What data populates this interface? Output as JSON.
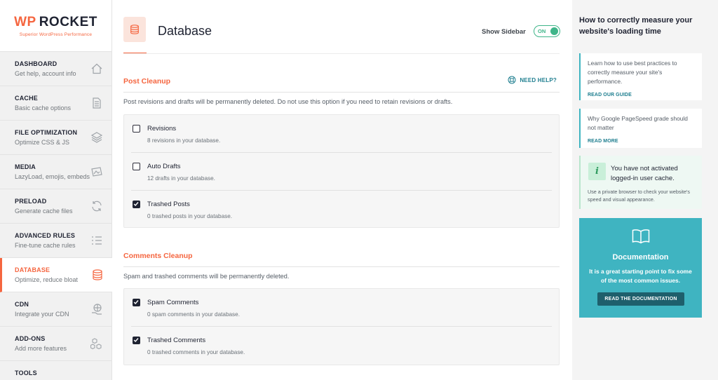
{
  "app": {
    "logo_wp": "WP",
    "logo_rocket": "ROCKET",
    "tagline": "Superior WordPress Performance"
  },
  "sidebar": {
    "items": [
      {
        "title": "DASHBOARD",
        "desc": "Get help, account info",
        "icon": "home-icon"
      },
      {
        "title": "CACHE",
        "desc": "Basic cache options",
        "icon": "file-icon"
      },
      {
        "title": "FILE OPTIMIZATION",
        "desc": "Optimize CSS & JS",
        "icon": "layers-icon"
      },
      {
        "title": "MEDIA",
        "desc": "LazyLoad, emojis, embeds",
        "icon": "image-icon"
      },
      {
        "title": "PRELOAD",
        "desc": "Generate cache files",
        "icon": "refresh-icon"
      },
      {
        "title": "ADVANCED RULES",
        "desc": "Fine-tune cache rules",
        "icon": "list-icon"
      },
      {
        "title": "DATABASE",
        "desc": "Optimize, reduce bloat",
        "icon": "database-icon",
        "active": true
      },
      {
        "title": "CDN",
        "desc": "Integrate your CDN",
        "icon": "globe-hand-icon"
      },
      {
        "title": "ADD-ONS",
        "desc": "Add more features",
        "icon": "cubes-icon"
      },
      {
        "title": "TOOLS",
        "desc": "",
        "icon": "tools-icon"
      }
    ]
  },
  "header": {
    "title": "Database",
    "show_sidebar_label": "Show Sidebar",
    "toggle_state": "ON"
  },
  "post_cleanup": {
    "title": "Post Cleanup",
    "need_help": "NEED HELP?",
    "description": "Post revisions and drafts will be permanently deleted. Do not use this option if you need to retain revisions or drafts.",
    "options": [
      {
        "label": "Revisions",
        "desc": "8 revisions in your database.",
        "checked": false
      },
      {
        "label": "Auto Drafts",
        "desc": "12 drafts in your database.",
        "checked": false
      },
      {
        "label": "Trashed Posts",
        "desc": "0 trashed posts in your database.",
        "checked": true
      }
    ]
  },
  "comments_cleanup": {
    "title": "Comments Cleanup",
    "description": "Spam and trashed comments will be permanently deleted.",
    "options": [
      {
        "label": "Spam Comments",
        "desc": "0 spam comments in your database.",
        "checked": true
      },
      {
        "label": "Trashed Comments",
        "desc": "0 trashed comments in your database.",
        "checked": true
      }
    ]
  },
  "right_panel": {
    "title": "How to correctly measure your website's loading time",
    "cards": [
      {
        "text": "Learn how to use best practices to correctly measure your site's performance.",
        "link": "READ OUR GUIDE"
      },
      {
        "text": "Why Google PageSpeed grade should not matter",
        "link": "READ MORE"
      }
    ],
    "notice": {
      "icon": "i",
      "title": "You have not activated logged-in user cache.",
      "desc": "Use a private browser to check your website's speed and visual appearance."
    },
    "documentation": {
      "title": "Documentation",
      "text": "It is a great starting point to fix some of the most common issues.",
      "button": "READ THE DOCUMENTATION"
    }
  },
  "colors": {
    "accent": "#f56640",
    "teal": "#3fb4c1",
    "green": "#3fb589",
    "dark": "#1f2332"
  }
}
